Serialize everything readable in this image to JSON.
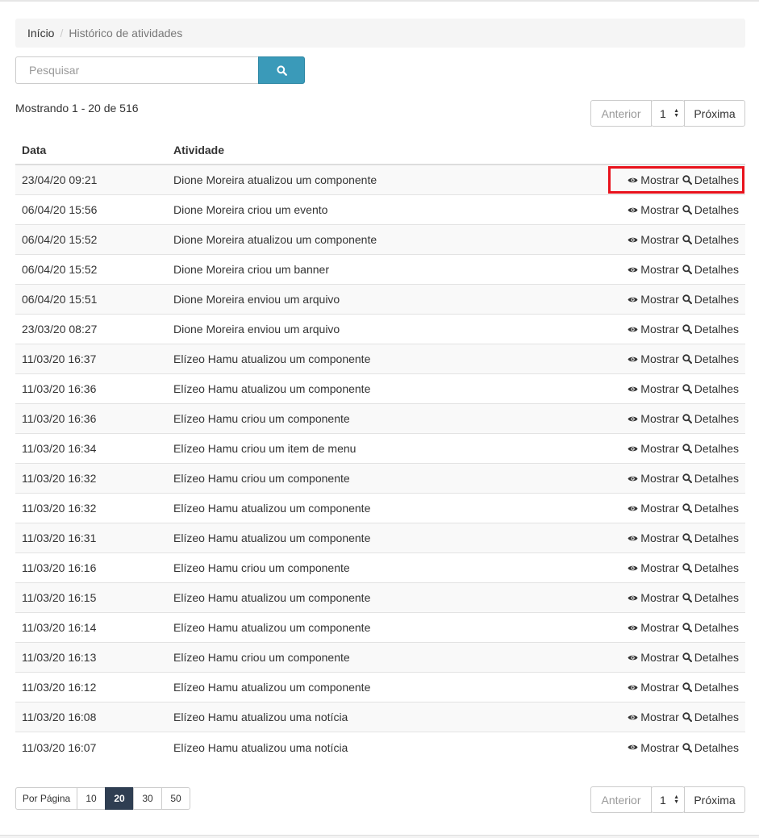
{
  "breadcrumb": {
    "home": "Início",
    "separator": "/",
    "current": "Histórico de atividades"
  },
  "search": {
    "placeholder": "Pesquisar",
    "value": "",
    "icon": "search-icon"
  },
  "summary": "Mostrando 1 - 20 de 516",
  "pager": {
    "prev_label": "Anterior",
    "page": "1",
    "next_label": "Próxima"
  },
  "table": {
    "headers": {
      "date": "Data",
      "activity": "Atividade"
    },
    "show_label": "Mostrar",
    "details_label": "Detalhes",
    "rows": [
      {
        "date": "23/04/20 09:21",
        "activity": "Dione Moreira atualizou um componente"
      },
      {
        "date": "06/04/20 15:56",
        "activity": "Dione Moreira criou um evento"
      },
      {
        "date": "06/04/20 15:52",
        "activity": "Dione Moreira atualizou um componente"
      },
      {
        "date": "06/04/20 15:52",
        "activity": "Dione Moreira criou um banner"
      },
      {
        "date": "06/04/20 15:51",
        "activity": "Dione Moreira enviou um arquivo"
      },
      {
        "date": "23/03/20 08:27",
        "activity": "Dione Moreira enviou um arquivo"
      },
      {
        "date": "11/03/20 16:37",
        "activity": "Elízeo Hamu atualizou um componente"
      },
      {
        "date": "11/03/20 16:36",
        "activity": "Elízeo Hamu atualizou um componente"
      },
      {
        "date": "11/03/20 16:36",
        "activity": "Elízeo Hamu criou um componente"
      },
      {
        "date": "11/03/20 16:34",
        "activity": "Elízeo Hamu criou um item de menu"
      },
      {
        "date": "11/03/20 16:32",
        "activity": "Elízeo Hamu criou um componente"
      },
      {
        "date": "11/03/20 16:32",
        "activity": "Elízeo Hamu atualizou um componente"
      },
      {
        "date": "11/03/20 16:31",
        "activity": "Elízeo Hamu atualizou um componente"
      },
      {
        "date": "11/03/20 16:16",
        "activity": "Elízeo Hamu criou um componente"
      },
      {
        "date": "11/03/20 16:15",
        "activity": "Elízeo Hamu atualizou um componente"
      },
      {
        "date": "11/03/20 16:14",
        "activity": "Elízeo Hamu atualizou um componente"
      },
      {
        "date": "11/03/20 16:13",
        "activity": "Elízeo Hamu criou um componente"
      },
      {
        "date": "11/03/20 16:12",
        "activity": "Elízeo Hamu atualizou um componente"
      },
      {
        "date": "11/03/20 16:08",
        "activity": "Elízeo Hamu atualizou uma notícia"
      },
      {
        "date": "11/03/20 16:07",
        "activity": "Elízeo Hamu atualizou uma notícia"
      }
    ]
  },
  "per_page": {
    "label": "Por Página",
    "options": [
      "10",
      "20",
      "30",
      "50"
    ],
    "selected": "20"
  },
  "colors": {
    "search_button": "#3a9ab9",
    "per_page_active": "#2f3e52",
    "highlight": "#e8121c"
  }
}
